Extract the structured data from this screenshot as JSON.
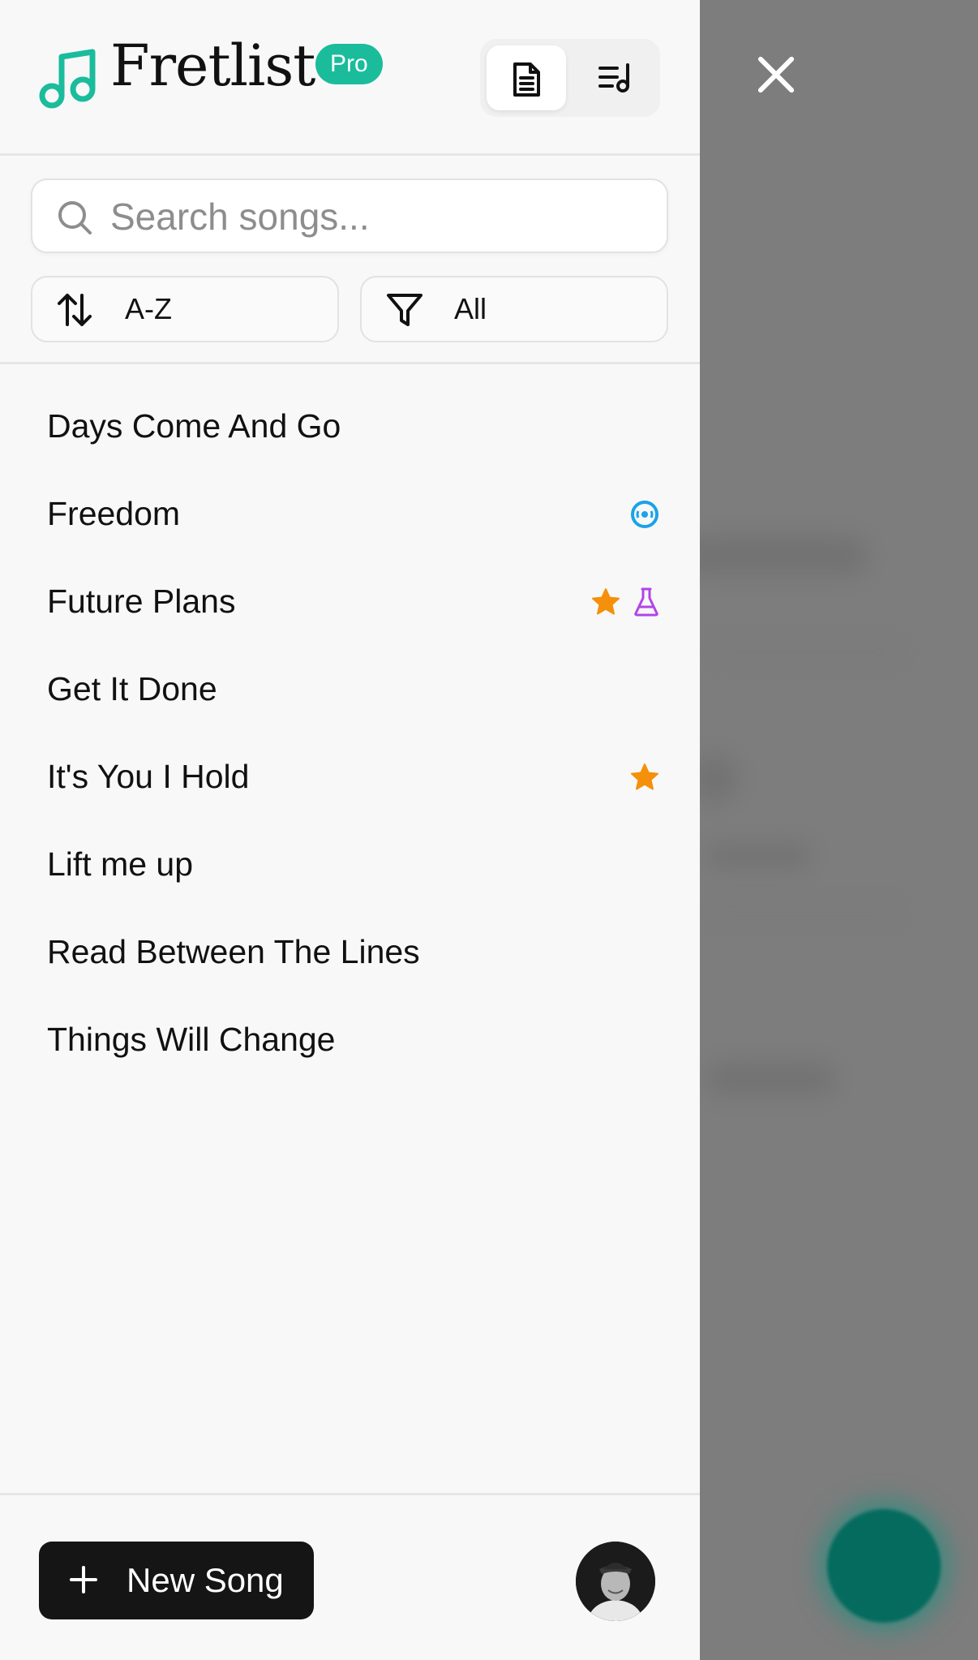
{
  "app": {
    "brand": "Fretlist",
    "badge": "Pro",
    "accent": "#1abc9c"
  },
  "view_modes": [
    {
      "icon": "document-icon",
      "active": true
    },
    {
      "icon": "playlist-icon",
      "active": false
    }
  ],
  "search": {
    "placeholder": "Search songs..."
  },
  "sort": {
    "icon": "sort-arrows-icon",
    "label": "A-Z"
  },
  "filter": {
    "icon": "filter-icon",
    "label": "All"
  },
  "songs": [
    {
      "title": "Days Come And Go",
      "icons": []
    },
    {
      "title": "Freedom",
      "icons": [
        "vinyl-record-icon"
      ]
    },
    {
      "title": "Future Plans",
      "icons": [
        "star-icon",
        "flask-icon"
      ]
    },
    {
      "title": "Get It Done",
      "icons": []
    },
    {
      "title": "It's You I Hold",
      "icons": [
        "star-icon"
      ]
    },
    {
      "title": "Lift me up",
      "icons": []
    },
    {
      "title": "Read Between The Lines",
      "icons": []
    },
    {
      "title": "Things Will Change",
      "icons": []
    }
  ],
  "footer": {
    "new_song_label": "New Song"
  },
  "colors": {
    "star": "#f5900a",
    "vinyl": "#1aa3e8",
    "flask": "#b145e8",
    "fab": "#046b5e"
  }
}
